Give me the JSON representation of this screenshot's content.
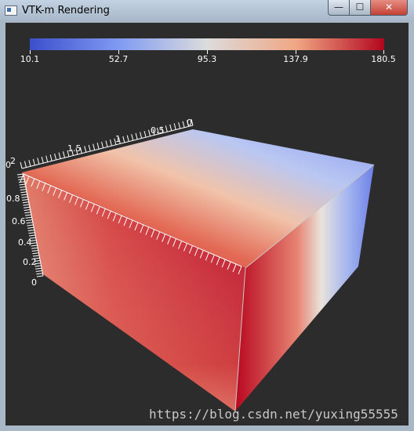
{
  "window": {
    "title": "VTK-m Rendering",
    "minimize_label": "—",
    "maximize_label": "☐",
    "close_label": "✕"
  },
  "colorbar": {
    "labels": [
      "10.1",
      "52.7",
      "95.3",
      "137.9",
      "180.5"
    ],
    "colors": [
      "#3c4fcc",
      "#7f9af2",
      "#dcdcdc",
      "#f0a784",
      "#b3061e"
    ]
  },
  "axes": {
    "top_ticks": [
      "0",
      "0.5",
      "1",
      "1.5",
      "2"
    ],
    "left_ticks": [
      "0",
      "0.2",
      "0.4",
      "0.6",
      "0.8"
    ],
    "left_top_label": "0"
  },
  "watermark": "https://blog.csdn.net/yuxing55555"
}
